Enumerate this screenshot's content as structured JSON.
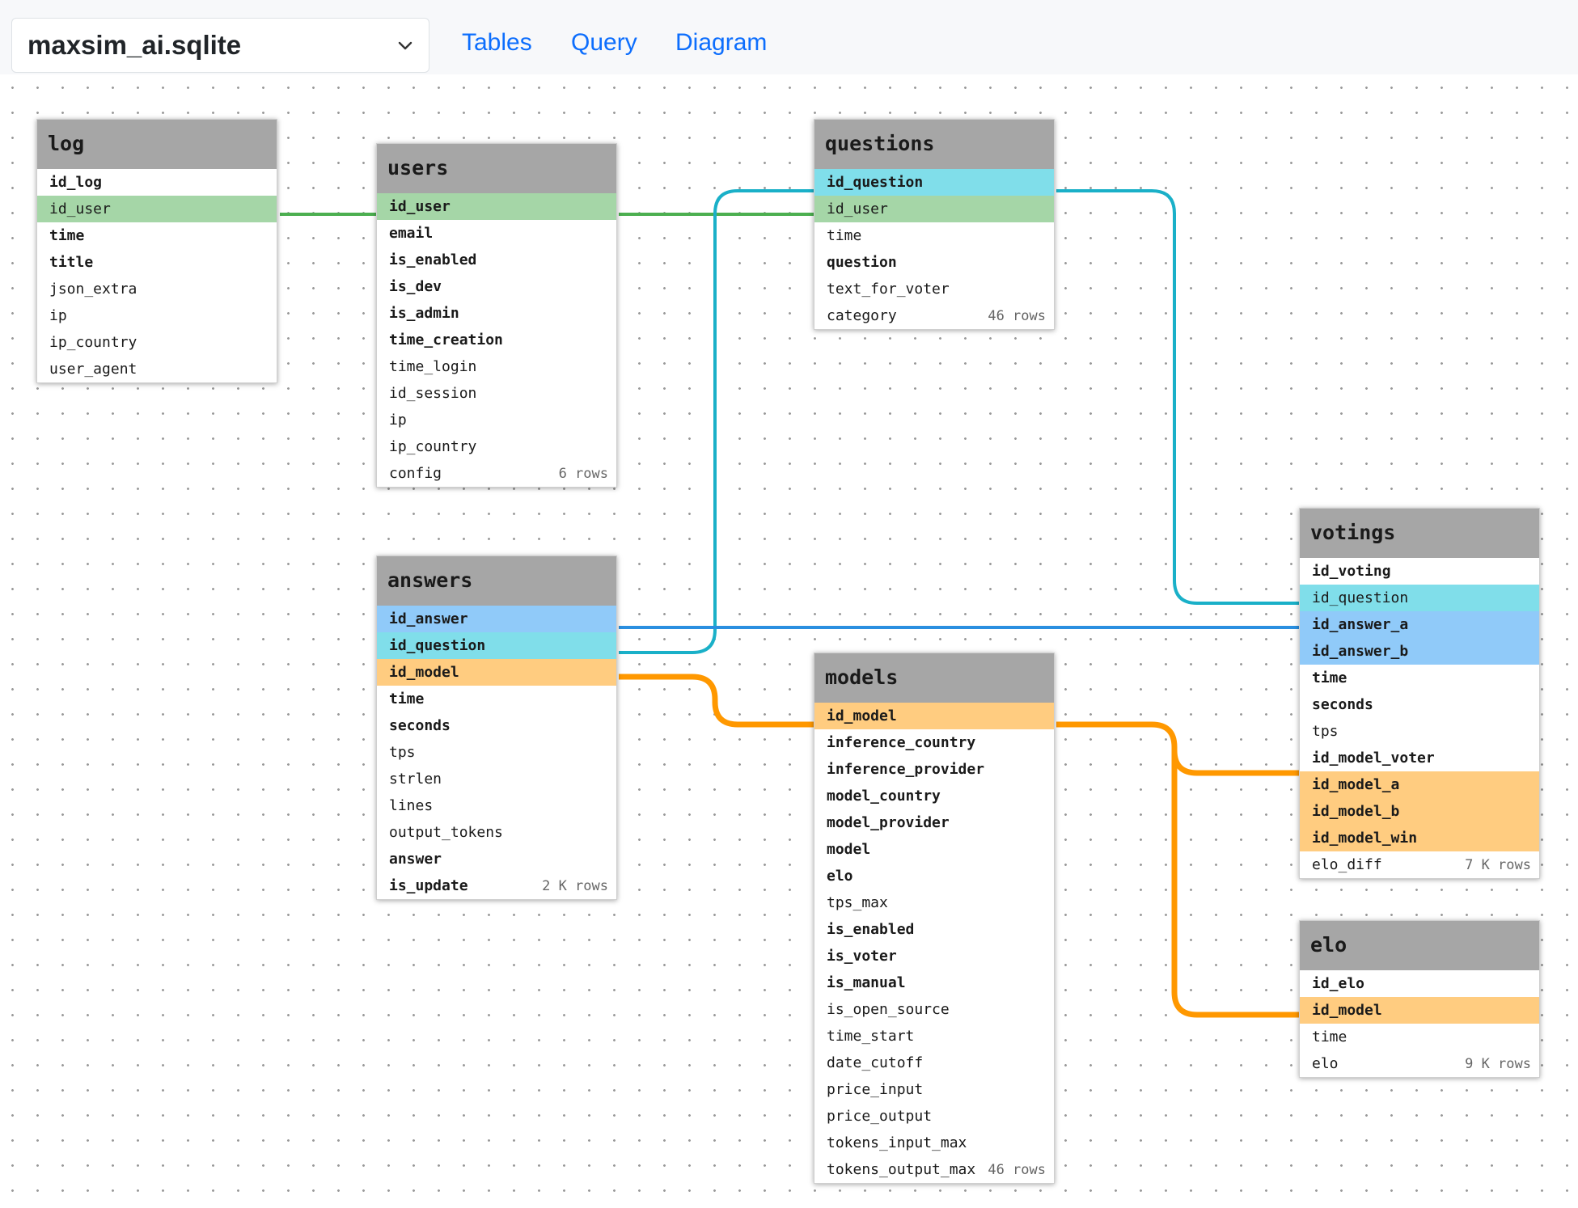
{
  "header": {
    "db_name": "maxsim_ai.sqlite",
    "nav": [
      "Tables",
      "Query",
      "Diagram"
    ]
  },
  "colors": {
    "fk_user": "#a5d6a7",
    "fk_question": "#80deea",
    "fk_answer": "#90caf9",
    "fk_model": "#ffcc80",
    "line_user": "#4caf50",
    "line_question": "#1ab0c8",
    "line_answer": "#2a8fe0",
    "line_model": "#ff9800"
  },
  "tables": [
    {
      "name": "log",
      "count": "",
      "columns": [
        {
          "name": "id_log",
          "bold": true,
          "fk": ""
        },
        {
          "name": "id_user",
          "bold": false,
          "fk": "user"
        },
        {
          "name": "time",
          "bold": true,
          "fk": ""
        },
        {
          "name": "title",
          "bold": true,
          "fk": ""
        },
        {
          "name": "json_extra",
          "bold": false,
          "fk": ""
        },
        {
          "name": "ip",
          "bold": false,
          "fk": ""
        },
        {
          "name": "ip_country",
          "bold": false,
          "fk": ""
        },
        {
          "name": "user_agent",
          "bold": false,
          "fk": ""
        }
      ]
    },
    {
      "name": "users",
      "count": "6 rows",
      "columns": [
        {
          "name": "id_user",
          "bold": true,
          "fk": "user"
        },
        {
          "name": "email",
          "bold": true,
          "fk": ""
        },
        {
          "name": "is_enabled",
          "bold": true,
          "fk": ""
        },
        {
          "name": "is_dev",
          "bold": true,
          "fk": ""
        },
        {
          "name": "is_admin",
          "bold": true,
          "fk": ""
        },
        {
          "name": "time_creation",
          "bold": true,
          "fk": ""
        },
        {
          "name": "time_login",
          "bold": false,
          "fk": ""
        },
        {
          "name": "id_session",
          "bold": false,
          "fk": ""
        },
        {
          "name": "ip",
          "bold": false,
          "fk": ""
        },
        {
          "name": "ip_country",
          "bold": false,
          "fk": ""
        },
        {
          "name": "config",
          "bold": false,
          "fk": ""
        }
      ]
    },
    {
      "name": "questions",
      "count": "46 rows",
      "columns": [
        {
          "name": "id_question",
          "bold": true,
          "fk": "question"
        },
        {
          "name": "id_user",
          "bold": false,
          "fk": "user"
        },
        {
          "name": "time",
          "bold": false,
          "fk": ""
        },
        {
          "name": "question",
          "bold": true,
          "fk": ""
        },
        {
          "name": "text_for_voter",
          "bold": false,
          "fk": ""
        },
        {
          "name": "category",
          "bold": false,
          "fk": ""
        }
      ]
    },
    {
      "name": "answers",
      "count": "2 K rows",
      "columns": [
        {
          "name": "id_answer",
          "bold": true,
          "fk": "answer"
        },
        {
          "name": "id_question",
          "bold": true,
          "fk": "question"
        },
        {
          "name": "id_model",
          "bold": true,
          "fk": "model"
        },
        {
          "name": "time",
          "bold": true,
          "fk": ""
        },
        {
          "name": "seconds",
          "bold": true,
          "fk": ""
        },
        {
          "name": "tps",
          "bold": false,
          "fk": ""
        },
        {
          "name": "strlen",
          "bold": false,
          "fk": ""
        },
        {
          "name": "lines",
          "bold": false,
          "fk": ""
        },
        {
          "name": "output_tokens",
          "bold": false,
          "fk": ""
        },
        {
          "name": "answer",
          "bold": true,
          "fk": ""
        },
        {
          "name": "is_update",
          "bold": true,
          "fk": ""
        }
      ]
    },
    {
      "name": "models",
      "count": "46 rows",
      "columns": [
        {
          "name": "id_model",
          "bold": true,
          "fk": "model"
        },
        {
          "name": "inference_country",
          "bold": true,
          "fk": ""
        },
        {
          "name": "inference_provider",
          "bold": true,
          "fk": ""
        },
        {
          "name": "model_country",
          "bold": true,
          "fk": ""
        },
        {
          "name": "model_provider",
          "bold": true,
          "fk": ""
        },
        {
          "name": "model",
          "bold": true,
          "fk": ""
        },
        {
          "name": "elo",
          "bold": true,
          "fk": ""
        },
        {
          "name": "tps_max",
          "bold": false,
          "fk": ""
        },
        {
          "name": "is_enabled",
          "bold": true,
          "fk": ""
        },
        {
          "name": "is_voter",
          "bold": true,
          "fk": ""
        },
        {
          "name": "is_manual",
          "bold": true,
          "fk": ""
        },
        {
          "name": "is_open_source",
          "bold": false,
          "fk": ""
        },
        {
          "name": "time_start",
          "bold": false,
          "fk": ""
        },
        {
          "name": "date_cutoff",
          "bold": false,
          "fk": ""
        },
        {
          "name": "price_input",
          "bold": false,
          "fk": ""
        },
        {
          "name": "price_output",
          "bold": false,
          "fk": ""
        },
        {
          "name": "tokens_input_max",
          "bold": false,
          "fk": ""
        },
        {
          "name": "tokens_output_max",
          "bold": false,
          "fk": ""
        }
      ]
    },
    {
      "name": "votings",
      "count": "7 K rows",
      "columns": [
        {
          "name": "id_voting",
          "bold": true,
          "fk": ""
        },
        {
          "name": "id_question",
          "bold": false,
          "fk": "question"
        },
        {
          "name": "id_answer_a",
          "bold": true,
          "fk": "answer"
        },
        {
          "name": "id_answer_b",
          "bold": true,
          "fk": "answer"
        },
        {
          "name": "time",
          "bold": true,
          "fk": ""
        },
        {
          "name": "seconds",
          "bold": true,
          "fk": ""
        },
        {
          "name": "tps",
          "bold": false,
          "fk": ""
        },
        {
          "name": "id_model_voter",
          "bold": true,
          "fk": ""
        },
        {
          "name": "id_model_a",
          "bold": true,
          "fk": "model"
        },
        {
          "name": "id_model_b",
          "bold": true,
          "fk": "model"
        },
        {
          "name": "id_model_win",
          "bold": true,
          "fk": "model"
        },
        {
          "name": "elo_diff",
          "bold": false,
          "fk": ""
        }
      ]
    },
    {
      "name": "elo",
      "count": "9 K rows",
      "columns": [
        {
          "name": "id_elo",
          "bold": true,
          "fk": ""
        },
        {
          "name": "id_model",
          "bold": true,
          "fk": "model"
        },
        {
          "name": "time",
          "bold": false,
          "fk": ""
        },
        {
          "name": "elo",
          "bold": false,
          "fk": ""
        }
      ]
    }
  ]
}
